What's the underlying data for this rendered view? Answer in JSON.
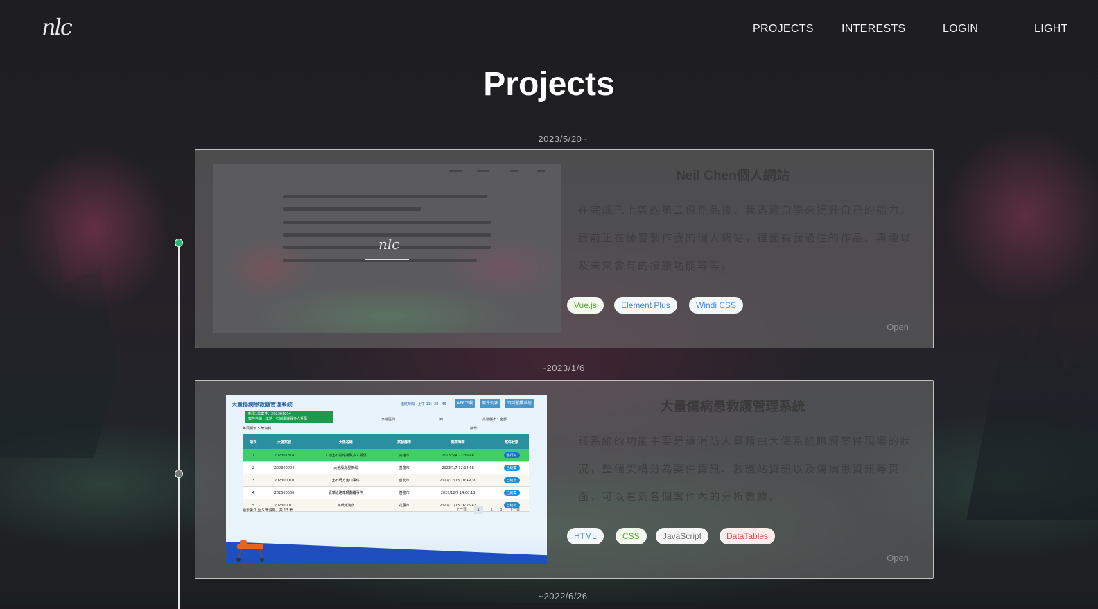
{
  "nav": {
    "logo": "nlc",
    "links": [
      "PROJECTS",
      "INTERESTS",
      "LOGIN",
      "LIGHT"
    ]
  },
  "page": {
    "title": "Projects"
  },
  "projects": [
    {
      "date": "2023/5/20~",
      "title": "Neil Chen個人網站",
      "description": "在完成已上架的第二份作品後，我透過自學來提升自己的能力，目前正在練習製作我的個人網站，裡面有我過往的作品、興趣以及未來會有的按讚功能等等。",
      "tags": [
        "Vue.js",
        "Element Plus",
        "Windi CSS"
      ],
      "open_label": "Open",
      "thumb_logo": "nlc"
    },
    {
      "date": "~2023/1/6",
      "title": "大量傷病患救護管理系統",
      "description": "該系統的功能主要是讓消防人員藉由大傷系統瞭解案件現場的狀況，整個架構分為案件資訊、救護站資訊以及傷病患資訊等頁面，可以看到各個案件內的分析數據。",
      "tags": [
        "HTML",
        "CSS",
        "JavaScript",
        "DataTables"
      ],
      "open_label": "Open",
      "thumb": {
        "title": "大量傷病患救護管理系統",
        "new_case": "新增1筆案件：202301814",
        "case_name": "案件名稱：工地土石崩塌導致多人受傷",
        "clock": "值班時間 - 上午 11：38：46",
        "buttons": [
          "APP下載",
          "案件列表",
          "回到選擇系統"
        ],
        "filter_date": "日期區間：",
        "filter_to": "到",
        "filter_city": "案發縣市：全部",
        "page_size": "每頁顯示 5 筆資料",
        "search": "搜尋:",
        "columns": [
          "項次",
          "大傷案號",
          "大傷名稱",
          "案發縣市",
          "開案時間",
          "案件狀態"
        ],
        "rows": [
          [
            "1",
            "202301814",
            "工地土石崩塌導致多人受傷",
            "高雄市",
            "2023/5/4 22:39:46",
            "進行中"
          ],
          [
            "2",
            "202300004",
            "大池廢房屋倒塌",
            "基隆市",
            "2023/1/7 12:14:08",
            "已結案"
          ],
          [
            "3",
            "202300010",
            "土石坍方走山事件",
            "台北市",
            "2022/12/13 10:49:30",
            "已結案"
          ],
          [
            "4",
            "202300006",
            "嘉華道路車輛翻覆事件",
            "基隆市",
            "2022/12/9 14:00:13",
            "已結案"
          ],
          [
            "5",
            "202300011",
            "瓦斯外洩案",
            "花蓮市",
            "2022/11/13 16:26:43",
            "已結案"
          ]
        ],
        "footer": "顯示第 1 至 5 筆資料，共 13 筆",
        "pager": [
          "上一頁",
          "1",
          "2",
          "3",
          "下一頁"
        ]
      }
    },
    {
      "date": "~2022/6/26"
    }
  ],
  "colors": {
    "timeline_active": "#2bb673",
    "tag_vue": "#5aa93a",
    "tag_element": "#3d8ee0",
    "tag_windi": "#3d8ee0",
    "tag_html": "#3d8ee0",
    "tag_css": "#5aa93a",
    "tag_js": "#777777",
    "tag_datatables": "#e04b4b"
  }
}
